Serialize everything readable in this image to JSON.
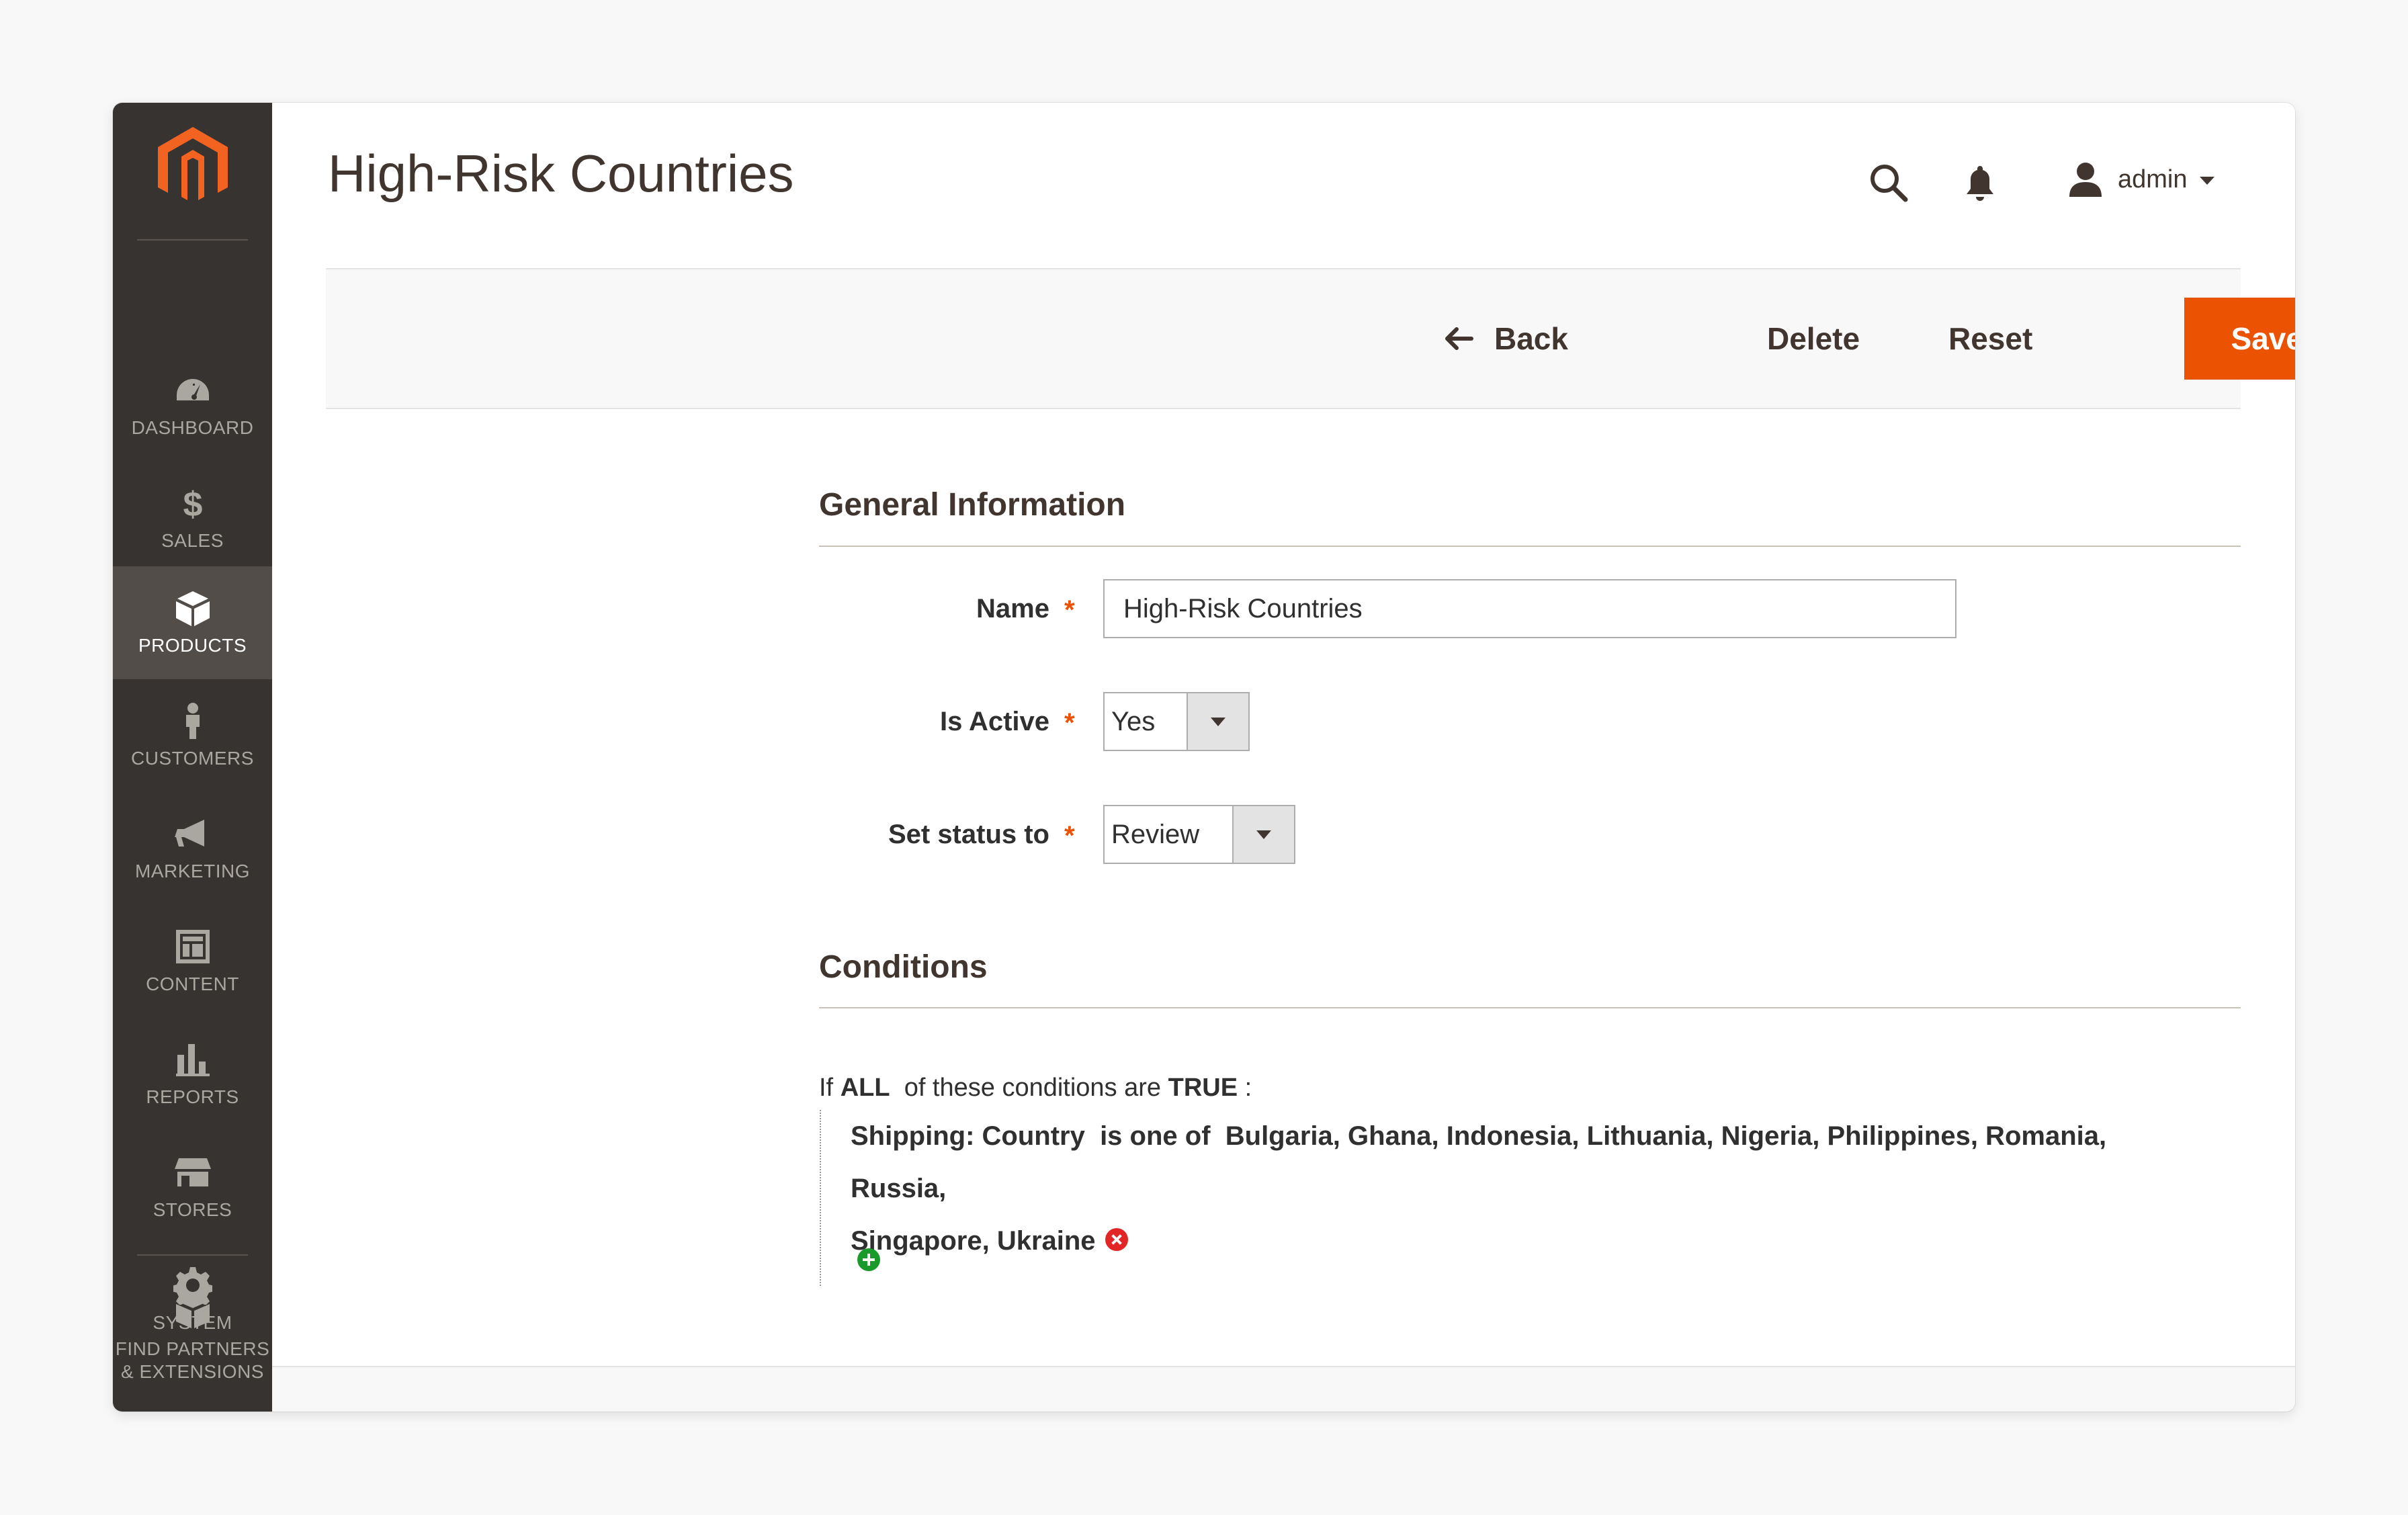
{
  "page": {
    "title": "High-Risk Countries"
  },
  "header": {
    "user_name": "admin"
  },
  "sidebar": {
    "items": [
      {
        "label": "DASHBOARD"
      },
      {
        "label": "SALES"
      },
      {
        "label": "PRODUCTS"
      },
      {
        "label": "CUSTOMERS"
      },
      {
        "label": "MARKETING"
      },
      {
        "label": "CONTENT"
      },
      {
        "label": "REPORTS"
      },
      {
        "label": "STORES"
      },
      {
        "label": "SYSTEM"
      },
      {
        "label_line1": "FIND PARTNERS",
        "label_line2": "& EXTENSIONS"
      }
    ],
    "active_item": "PRODUCTS"
  },
  "actions": {
    "back_label": "Back",
    "delete_label": "Delete",
    "reset_label": "Reset",
    "save_label": "Save"
  },
  "general": {
    "section_title": "General Information",
    "name_label": "Name",
    "name_value": "High-Risk Countries",
    "is_active_label": "Is Active",
    "is_active_value": "Yes",
    "status_label": "Set status to",
    "status_value": "Review",
    "required_marker": "*"
  },
  "conditions": {
    "section_title": "Conditions",
    "if_text": "If",
    "aggregator": "ALL",
    "mid_text": "of these conditions are",
    "value": "TRUE",
    "colon": ":",
    "rule_attribute": "Shipping: Country",
    "rule_operator": "is one of",
    "rule_values_line1": "Bulgaria, Ghana, Indonesia, Lithuania, Nigeria, Philippines, Romania, Russia,",
    "rule_values_line2": "Singapore, Ukraine"
  },
  "colors": {
    "accent": "#eb5202",
    "sidebar_bg": "#373330",
    "sidebar_active": "#524d49",
    "remove": "#e22626",
    "add": "#1b9a2c"
  },
  "icons": [
    "magento-logo-icon",
    "dashboard-icon",
    "dollar-icon",
    "box-icon",
    "person-icon",
    "megaphone-icon",
    "layout-icon",
    "bar-chart-icon",
    "storefront-icon",
    "gear-icon",
    "blocks-icon",
    "search-icon",
    "bell-icon",
    "user-icon",
    "arrow-left-icon",
    "remove-condition-icon",
    "add-condition-icon"
  ]
}
